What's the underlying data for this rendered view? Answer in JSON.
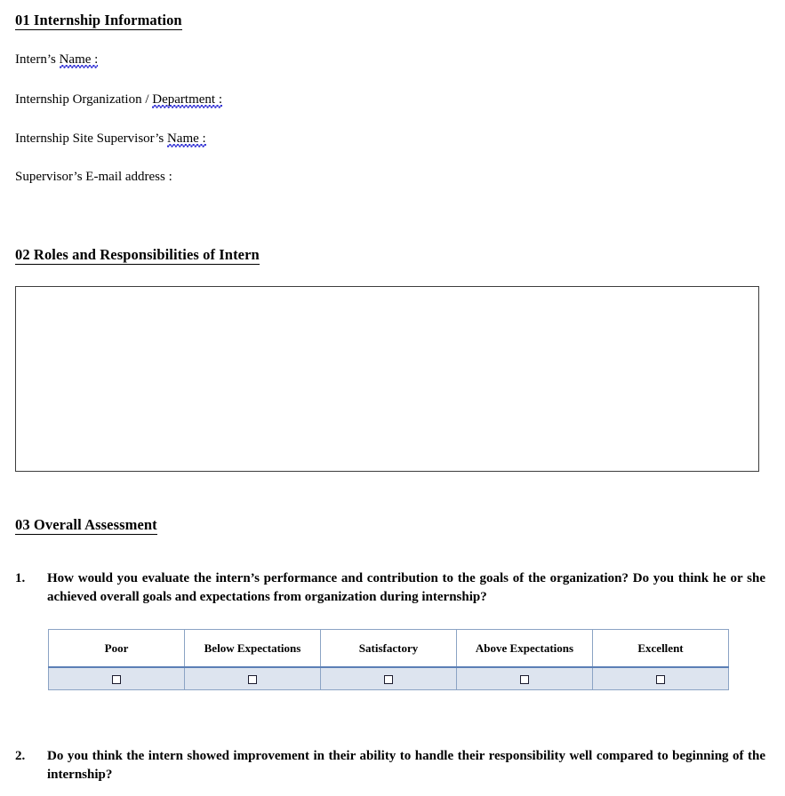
{
  "document": {
    "sections": [
      {
        "id": "internship-information",
        "heading": "01 Internship Information",
        "fields": [
          {
            "label_before": "Intern’s ",
            "label_spell": "Name :",
            "full": "Intern’s Name :"
          },
          {
            "label_before": "Internship Organization / ",
            "label_spell": "Department :",
            "full": "Internship Organization / Department :"
          },
          {
            "label_before": "Internship Site Supervisor’s ",
            "label_spell": "Name :",
            "full": "Internship Site Supervisor’s Name :"
          },
          {
            "label_before": "Supervisor’s E-mail address :",
            "label_spell": "",
            "full": "Supervisor’s E-mail address :"
          }
        ]
      },
      {
        "id": "roles-and-responsibilities",
        "heading": "02 Roles and Responsibilities of Intern",
        "answer_box_value": ""
      },
      {
        "id": "overall-assessment",
        "heading": "03 Overall Assessment",
        "questions": [
          {
            "number": "1.",
            "text": "How would you evaluate the intern’s performance and contribution to the goals of the organization? Do you think he or she achieved overall goals and expectations from organization during internship?"
          },
          {
            "number": "2.",
            "text": "Do you think the intern showed improvement in their ability to handle their responsibility well compared to beginning of the internship?"
          }
        ]
      }
    ]
  },
  "rating_scale": {
    "options": [
      {
        "label": "Poor",
        "checked": false
      },
      {
        "label": "Below Expectations",
        "checked": false
      },
      {
        "label": "Satisfactory",
        "checked": false
      },
      {
        "label": "Above Expectations",
        "checked": false
      },
      {
        "label": "Excellent",
        "checked": false
      }
    ]
  },
  "colors": {
    "heading_text": "#000000",
    "body_text": "#000000",
    "box_border": "#3d3d3d",
    "table_border": "#8ba3c4",
    "table_header_bg": "#ffffff",
    "table_row_bg": "#dde4ef",
    "table_divider": "#5b7fb5",
    "spellcheck_underline": "#2b2bd4",
    "page_bg": "#ffffff"
  }
}
